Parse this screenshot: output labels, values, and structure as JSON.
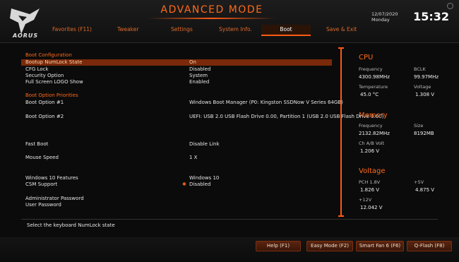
{
  "header": {
    "mode_title": "ADVANCED MODE",
    "brand": "AORUS",
    "date": "12/07/2020",
    "day": "Monday",
    "time": "15:32"
  },
  "tabs": [
    {
      "label": "Favorites (F11)"
    },
    {
      "label": "Tweaker"
    },
    {
      "label": "Settings"
    },
    {
      "label": "System Info."
    },
    {
      "label": "Boot",
      "active": true
    },
    {
      "label": "Save & Exit"
    }
  ],
  "boot": {
    "section_config": "Boot Configuration",
    "numlock_label": "Bootup NumLock State",
    "numlock_value": "On",
    "cfglock_label": "CFG Lock",
    "cfglock_value": "Disabled",
    "security_label": "Security Option",
    "security_value": "System",
    "logo_label": "Full Screen LOGO Show",
    "logo_value": "Enabled",
    "section_priorities": "Boot Option Priorities",
    "opt1_label": "Boot Option #1",
    "opt1_value": "Windows Boot Manager (P0: Kingston SSDNow V Series 64GB)",
    "opt2_label": "Boot Option #2",
    "opt2_value": "UEFI: USB 2.0 USB Flash Drive 0.00, Partition 1 (USB 2.0 USB Flash Drive 0.00)",
    "fastboot_label": "Fast Boot",
    "fastboot_value": "Disable Link",
    "mouse_label": "Mouse Speed",
    "mouse_value": "1 X",
    "win10_label": "Windows 10 Features",
    "win10_value": "Windows 10",
    "csm_label": "CSM Support",
    "csm_value": "Disabled",
    "admin_label": "Administrator Password",
    "user_label": "User Password"
  },
  "side": {
    "cpu_title": "CPU",
    "freq_k": "Frequency",
    "freq_v": "4300.98MHz",
    "bclk_k": "BCLK",
    "bclk_v": "99.97MHz",
    "temp_k": "Temperature",
    "temp_v": "45.0 °C",
    "volt_k": "Voltage",
    "volt_v": "1.308 V",
    "mem_title": "Memory",
    "mfreq_k": "Frequency",
    "mfreq_v": "2132.82MHz",
    "size_k": "Size",
    "size_v": "8192MB",
    "chab_k": "Ch A/B Volt",
    "chab_v": "1.206 V",
    "volt_title": "Voltage",
    "pch_k": "PCH 1.8V",
    "pch_v": "1.826 V",
    "p5_k": "+5V",
    "p5_v": "4.875 V",
    "p12_k": "+12V",
    "p12_v": "12.042 V"
  },
  "help_text": "Select the keyboard NumLock state",
  "footer": {
    "help": "Help (F1)",
    "easy": "Easy Mode (F2)",
    "fan": "Smart Fan 6 (F6)",
    "qflash": "Q-Flash (F8)"
  },
  "colors": {
    "accent": "#ff6a1a",
    "highlight": "#7a2a0a"
  }
}
